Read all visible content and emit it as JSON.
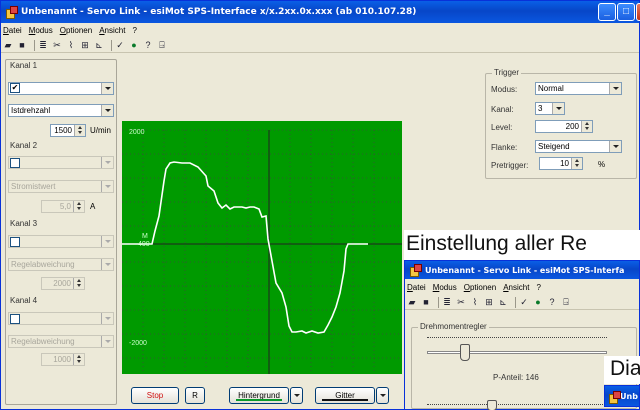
{
  "main_window": {
    "title": "Unbenannt - Servo Link - esiMot SPS-Interface x/x.2xx.0x.xxx (ab 010.107.28)",
    "menu": [
      "Datei",
      "Modus",
      "Optionen",
      "Ansicht",
      "?"
    ],
    "toolbar_icons": [
      "open-icon",
      "save-icon",
      "properties-icon",
      "tools-icon",
      "signal-icon",
      "network-icon",
      "chart-icon",
      "check-icon",
      "globe-icon",
      "help-icon",
      "exit-icon"
    ]
  },
  "channels": {
    "kanal1": {
      "label": "Kanal 1",
      "checked": true,
      "check_mark": "✔",
      "signal": "Istdrehzahl",
      "value": "1500",
      "unit": "U/min"
    },
    "kanal2": {
      "label": "Kanal 2",
      "checked": false,
      "signal": "Stromistwert",
      "value": "5,0",
      "unit": "A"
    },
    "kanal3": {
      "label": "Kanal 3",
      "checked": false,
      "signal": "Regelabweichung",
      "value": "2000"
    },
    "kanal4": {
      "label": "Kanal 4",
      "checked": false,
      "signal": "Regelabweichung",
      "value": "1000"
    }
  },
  "trigger": {
    "title": "Trigger",
    "modus_label": "Modus:",
    "modus": "Normal",
    "kanal_label": "Kanal:",
    "kanal": "3",
    "level_label": "Level:",
    "level": "200",
    "flanke_label": "Flanke:",
    "flanke": "Steigend",
    "pretrigger_label": "Pretrigger:",
    "pretrigger": "10",
    "pretrigger_unit": "%"
  },
  "scope": {
    "y_ticks": {
      "top": "2000",
      "mid": "400",
      "bottom": "-2000"
    },
    "marker": "M",
    "trace_color": "#ffffff",
    "background_color": "#009a00"
  },
  "bottom_bar": {
    "stop": "Stop",
    "r": "R",
    "hintergrund": "Hintergrund",
    "gitter": "Gitter"
  },
  "overlay_captions": {
    "einstellung": "Einstellung aller Re",
    "dia": "Dia"
  },
  "second_window": {
    "title": "Unbenannt - Servo Link - esiMot SPS-Interfa",
    "menu": [
      "Datei",
      "Modus",
      "Optionen",
      "Ansicht",
      "?"
    ],
    "group": "Drehmomentregler",
    "p_anteil": "P-Anteil: 146"
  },
  "taskbar_third": {
    "label": "Unb"
  }
}
